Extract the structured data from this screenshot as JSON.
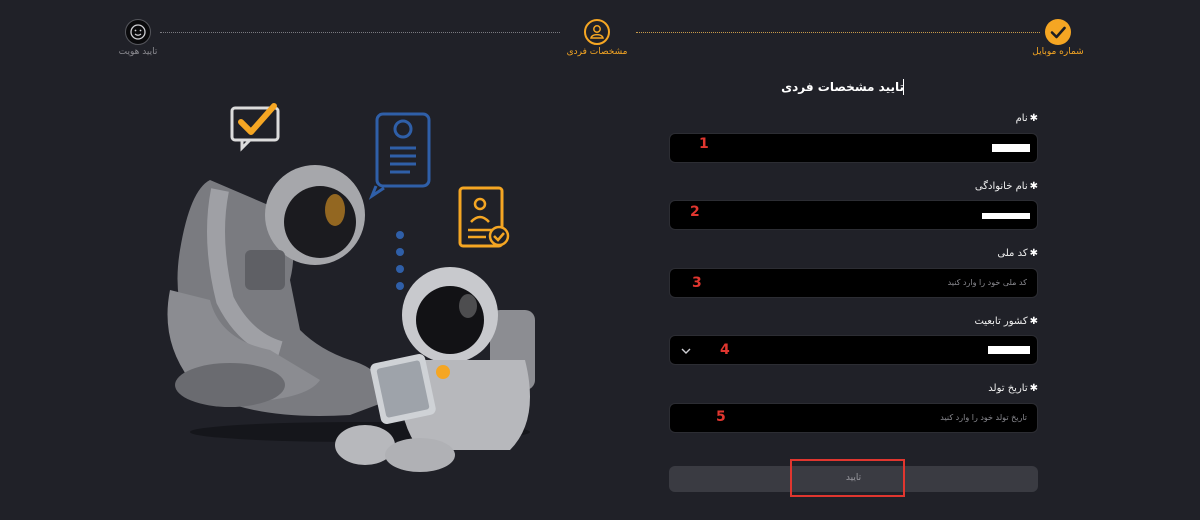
{
  "stepper": {
    "steps": [
      {
        "label": "شماره موبایل",
        "state": "done",
        "icon": "check-icon"
      },
      {
        "label": "مشخصات فردی",
        "state": "current",
        "icon": "user-icon"
      },
      {
        "label": "تایید هویت",
        "state": "pending",
        "icon": "smiley-icon"
      }
    ]
  },
  "form": {
    "title": "تایید مشخصات فردی",
    "required_mark": "✱",
    "fields": [
      {
        "label": "نام",
        "placeholder": "",
        "annotation": "1",
        "masked": true
      },
      {
        "label": "نام خانوادگی",
        "placeholder": "",
        "annotation": "2",
        "masked": true
      },
      {
        "label": "کد ملی",
        "placeholder": "کد ملی خود را وارد کنید",
        "annotation": "3",
        "masked": false
      },
      {
        "label": "کشور تابعیت",
        "placeholder": "",
        "annotation": "4",
        "masked": true,
        "type": "select"
      },
      {
        "label": "تاریخ تولد",
        "placeholder": "تاریخ تولد خود را وارد کنید",
        "annotation": "5",
        "masked": false
      }
    ],
    "submit_label": "تایید"
  },
  "colors": {
    "accent": "#f5a623",
    "background": "#202128",
    "field_bg": "#000000",
    "annotation_red": "#e0362f",
    "icon_blue": "#2f5fa8"
  }
}
